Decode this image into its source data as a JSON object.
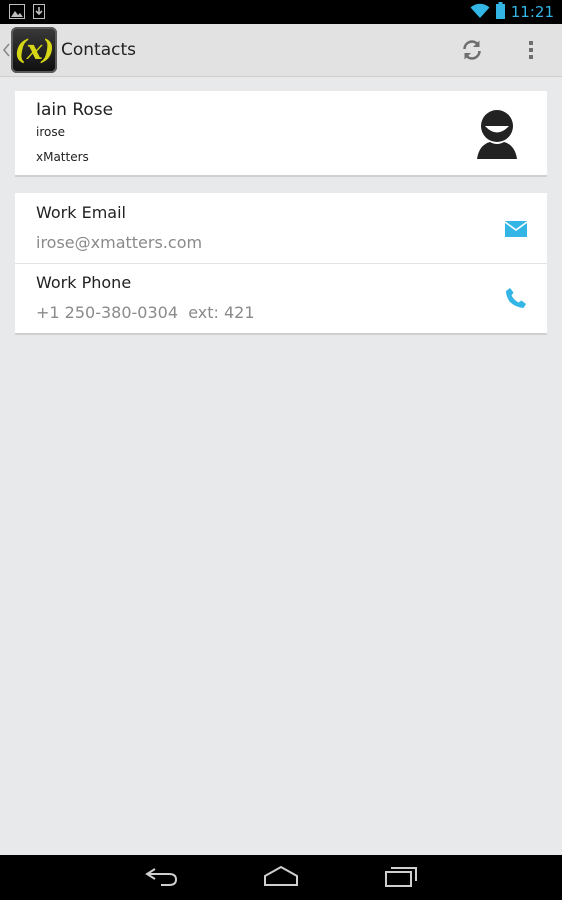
{
  "status_bar": {
    "time": "11:21",
    "icons": [
      "gallery-notification-icon",
      "download-notification-icon",
      "wifi-icon",
      "battery-icon"
    ],
    "accent_color": "#33b5e5"
  },
  "action_bar": {
    "logo_text": "(x)",
    "title": "Contacts",
    "actions": [
      "refresh-icon",
      "overflow-menu-icon"
    ]
  },
  "contact": {
    "name": "Iain Rose",
    "username": "irose",
    "company": "xMatters",
    "avatar_icon": "avatar-icon"
  },
  "details": [
    {
      "label": "Work Email",
      "value": "irose@xmatters.com",
      "icon": "email-icon"
    },
    {
      "label": "Work Phone",
      "value": "+1 250-380-0304  ext: 421",
      "icon": "phone-icon"
    }
  ],
  "colors": {
    "background": "#e8e9ea",
    "action_icon": "#33b5e5",
    "logo_accent": "#d6d617"
  },
  "nav_bar": {
    "buttons": [
      "back-icon",
      "home-icon",
      "recents-icon"
    ]
  }
}
